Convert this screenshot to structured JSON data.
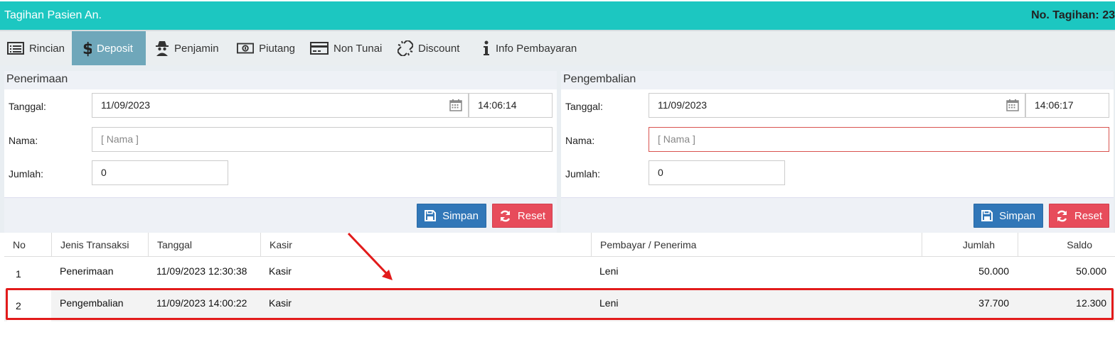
{
  "header": {
    "title": "Tagihan Pasien An.",
    "bill_no": "No. Tagihan: 23"
  },
  "tabs": [
    {
      "label": "Rincian",
      "icon": "list-icon",
      "active": false
    },
    {
      "label": "Deposit",
      "icon": "dollar-icon",
      "active": true
    },
    {
      "label": "Penjamin",
      "icon": "spy-icon",
      "active": false
    },
    {
      "label": "Piutang",
      "icon": "money-icon",
      "active": false
    },
    {
      "label": "Non Tunai",
      "icon": "card-icon",
      "active": false
    },
    {
      "label": "Discount",
      "icon": "unlink-icon",
      "active": false
    },
    {
      "label": "Info Pembayaran",
      "icon": "info-icon",
      "active": false
    }
  ],
  "penerimaan": {
    "title": "Penerimaan",
    "tanggal_label": "Tanggal:",
    "tanggal_value": "11/09/2023",
    "jam_value": "14:06:14",
    "nama_label": "Nama:",
    "nama_placeholder": "[ Nama ]",
    "jumlah_label": "Jumlah:",
    "jumlah_value": "0",
    "save_label": "Simpan",
    "reset_label": "Reset"
  },
  "pengembalian": {
    "title": "Pengembalian",
    "tanggal_label": "Tanggal:",
    "tanggal_value": "11/09/2023",
    "jam_value": "14:06:17",
    "nama_label": "Nama:",
    "nama_placeholder": "[ Nama ]",
    "jumlah_label": "Jumlah:",
    "jumlah_value": "0",
    "save_label": "Simpan",
    "reset_label": "Reset"
  },
  "table": {
    "columns": [
      "No",
      "Jenis Transaksi",
      "Tanggal",
      "Kasir",
      "Pembayar / Penerima",
      "Jumlah",
      "Saldo"
    ],
    "rows": [
      [
        "1",
        "Penerimaan",
        "11/09/2023 12:30:38",
        "Kasir",
        "Leni",
        "50.000",
        "50.000"
      ],
      [
        "2",
        "Pengembalian",
        "11/09/2023 14:00:22",
        "Kasir",
        "Leni",
        "37.700",
        "12.300"
      ]
    ]
  },
  "colors": {
    "header": "#1cc7c1",
    "active_tab": "#6fa7ba",
    "save": "#3177b8",
    "reset": "#e74c5b",
    "highlight": "#e21b1b"
  }
}
